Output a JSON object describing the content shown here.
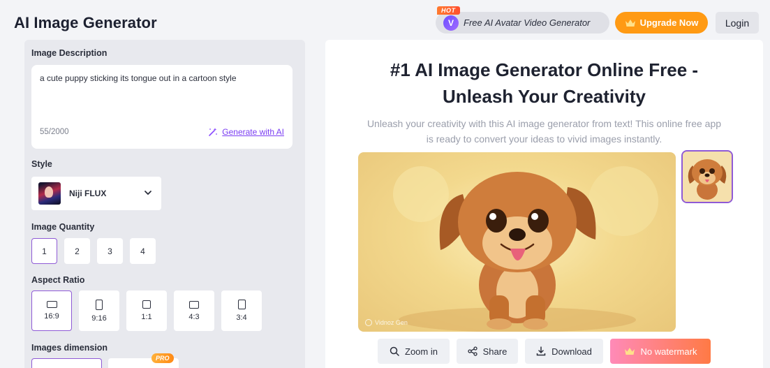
{
  "header": {
    "title": "AI Image Generator",
    "promo": {
      "badge": "HOT",
      "logo_letter": "V",
      "label": "Free AI Avatar Video Generator"
    },
    "upgrade_label": "Upgrade Now",
    "login_label": "Login"
  },
  "left": {
    "description": {
      "label": "Image Description",
      "value": "a cute puppy sticking its tongue out in a cartoon style",
      "count": "55/2000",
      "generate_ai": "Generate with AI"
    },
    "style": {
      "label": "Style",
      "selected": "Niji FLUX"
    },
    "quantity": {
      "label": "Image Quantity",
      "options": [
        "1",
        "2",
        "3",
        "4"
      ],
      "selected": "1"
    },
    "aspect": {
      "label": "Aspect Ratio",
      "options": [
        "16:9",
        "9:16",
        "1:1",
        "4:3",
        "3:4"
      ],
      "selected": "16:9"
    },
    "dimension": {
      "label": "Images dimension",
      "pro_badge": "PRO"
    }
  },
  "right": {
    "title_line1": "#1 AI Image Generator Online Free -",
    "title_line2": "Unleash Your Creativity",
    "sub_line1": "Unleash your creativity with this AI image generator from text! This online free app",
    "sub_line2": "is ready to convert your ideas to vivid images instantly.",
    "watermark": "Vidnoz Gen",
    "actions": {
      "zoom": "Zoom in",
      "share": "Share",
      "download": "Download",
      "no_watermark": "No watermark"
    }
  },
  "colors": {
    "accent": "#8f5ad6",
    "upgrade": "#ff9a14",
    "link": "#7a3df2"
  }
}
